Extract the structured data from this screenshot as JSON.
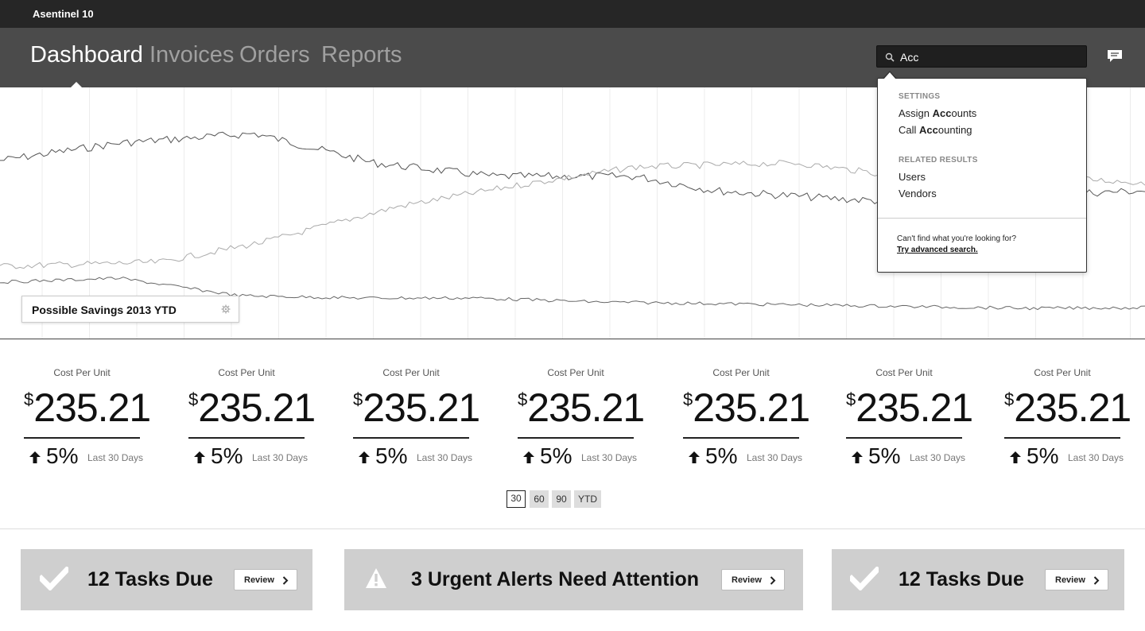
{
  "app": {
    "title": "Asentinel 10"
  },
  "nav": {
    "tabs": [
      {
        "label": "Dashboard",
        "active": true
      },
      {
        "label": "Invoices",
        "active": false
      },
      {
        "label": "Orders",
        "active": false
      },
      {
        "label": "Reports",
        "active": false
      }
    ]
  },
  "search": {
    "value": "Acc",
    "icon": "search-icon",
    "dropdown": {
      "settings_header": "SETTINGS",
      "settings_items": [
        {
          "prefix": "Assign ",
          "match": "Acc",
          "suffix": "ounts"
        },
        {
          "prefix": "Call ",
          "match": "Acc",
          "suffix": "ounting"
        }
      ],
      "related_header": "RELATED RESULTS",
      "related_items": [
        "Users",
        "Vendors"
      ],
      "help_text": "Can't find what you're looking for?",
      "help_link": "Try advanced search."
    }
  },
  "chart_panel": {
    "title": "Possible Savings 2013 YTD",
    "icon": "gear-icon"
  },
  "metrics": [
    {
      "label": "Cost Per Unit",
      "currency": "$",
      "value": "235.21",
      "change": "5%",
      "direction": "up",
      "period": "Last 30 Days"
    },
    {
      "label": "Cost Per Unit",
      "currency": "$",
      "value": "235.21",
      "change": "5%",
      "direction": "up",
      "period": "Last 30 Days"
    },
    {
      "label": "Cost Per Unit",
      "currency": "$",
      "value": "235.21",
      "change": "5%",
      "direction": "up",
      "period": "Last 30 Days"
    },
    {
      "label": "Cost Per Unit",
      "currency": "$",
      "value": "235.21",
      "change": "5%",
      "direction": "up",
      "period": "Last 30 Days"
    },
    {
      "label": "Cost Per Unit",
      "currency": "$",
      "value": "235.21",
      "change": "5%",
      "direction": "up",
      "period": "Last 30 Days"
    },
    {
      "label": "Cost Per Unit",
      "currency": "$",
      "value": "235.21",
      "change": "5%",
      "direction": "up",
      "period": "Last 30 Days"
    },
    {
      "label": "Cost Per Unit",
      "currency": "$",
      "value": "235.21",
      "change": "5%",
      "direction": "up",
      "period": "Last 30 Days"
    }
  ],
  "ranges": [
    {
      "label": "30",
      "active": true
    },
    {
      "label": "60",
      "active": false
    },
    {
      "label": "90",
      "active": false
    },
    {
      "label": "YTD",
      "active": false
    }
  ],
  "cards": [
    {
      "title": "12 Tasks Due",
      "button": "Review",
      "icon": "check-icon"
    },
    {
      "title": "3 Urgent Alerts Need Attention",
      "button": "Review",
      "icon": "warning-icon"
    },
    {
      "title": "12 Tasks Due",
      "button": "Review",
      "icon": "check-icon"
    }
  ],
  "colors": {
    "appbar": "#262626",
    "navbar": "#4b4b4b",
    "card": "#cfcfcf"
  }
}
